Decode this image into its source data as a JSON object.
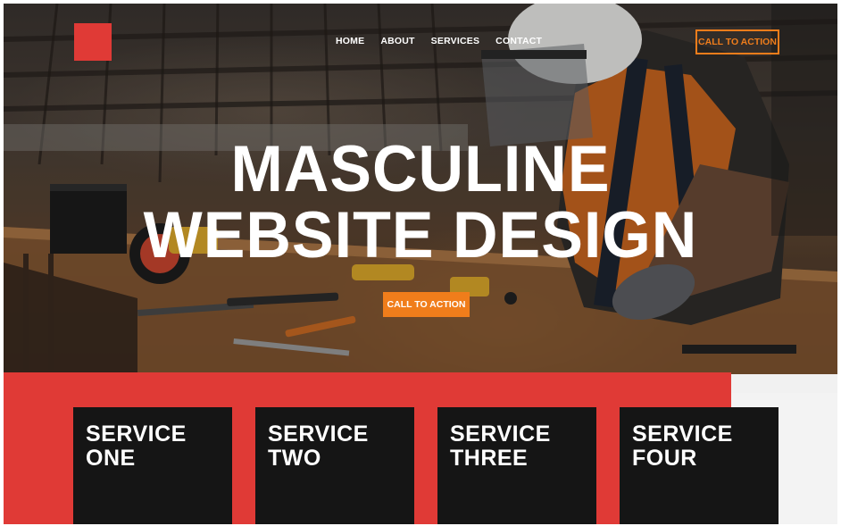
{
  "header": {
    "logo": "red-square-logo",
    "nav": [
      "HOME",
      "ABOUT",
      "SERVICES",
      "CONTACT"
    ],
    "cta_label": "CALL TO ACTION"
  },
  "hero": {
    "headline_line1": "MASCULINE",
    "headline_line2": "WEBSITE DESIGN",
    "cta_label": "CALL TO ACTION"
  },
  "services": [
    {
      "line1": "SERVICE",
      "line2": "ONE"
    },
    {
      "line1": "SERVICE",
      "line2": "TWO"
    },
    {
      "line1": "SERVICE",
      "line2": "THREE"
    },
    {
      "line1": "SERVICE",
      "line2": "FOUR"
    }
  ],
  "colors": {
    "brand_red": "#e03a36",
    "accent_orange": "#f07d1b",
    "card_dark": "#151515"
  }
}
